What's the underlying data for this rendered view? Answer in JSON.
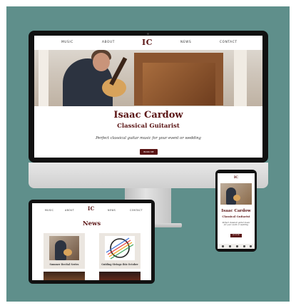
{
  "desktop": {
    "nav_items": [
      "MUSIC",
      "ABOUT",
      "NEWS",
      "CONTACT"
    ],
    "logo": "IC",
    "hero": {
      "name": "Isaac Cardow",
      "subtitle": "Classical Guitarist",
      "tagline": "Perfect classical guitar music for your event or wedding",
      "button_label": "BOOK ME"
    }
  },
  "tablet": {
    "nav_items": [
      "MUSIC",
      "ABOUT",
      "NEWS",
      "CONTACT"
    ],
    "logo": "IC",
    "section_title": "News",
    "cards": [
      {
        "caption": "Summer Recital Series"
      },
      {
        "caption": "Guiding Strings this October"
      }
    ]
  },
  "phone": {
    "logo": "IC",
    "name": "Isaac Cardow",
    "subtitle": "Classical Guitarist",
    "tagline": "Perfect classical guitar music for your event or wedding",
    "button_label": "BOOK ME"
  },
  "colors": {
    "brand": "#5a1414",
    "background": "#5f8f8b"
  }
}
